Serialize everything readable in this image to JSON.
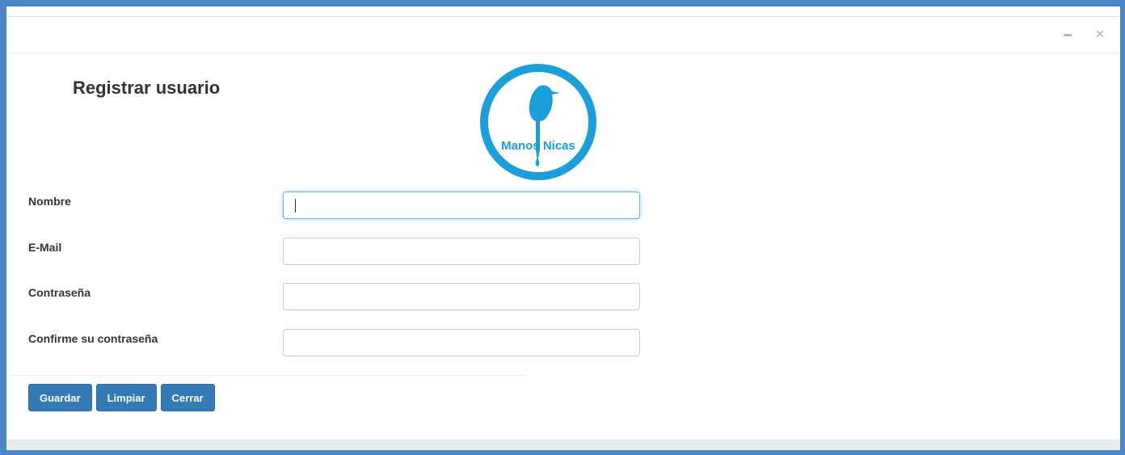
{
  "window": {
    "controls": {
      "minimize_icon": "minimize-icon",
      "close_icon": "close-icon"
    }
  },
  "page": {
    "title": "Registrar usuario"
  },
  "logo": {
    "text": "Manos Nicas",
    "color": "#1a9fdb"
  },
  "form": {
    "fields": [
      {
        "label": "Nombre",
        "value": "",
        "placeholder": ""
      },
      {
        "label": "E-Mail",
        "value": "",
        "placeholder": ""
      },
      {
        "label": "Contraseña",
        "value": "",
        "placeholder": ""
      },
      {
        "label": "Confirme su contraseña",
        "value": "",
        "placeholder": ""
      }
    ]
  },
  "actions": {
    "save_label": "Guardar",
    "clear_label": "Limpiar",
    "close_label": "Cerrar"
  },
  "colors": {
    "frame": "#4a86c8",
    "primary_button": "#337ab7",
    "focus_ring": "#66afe9"
  }
}
